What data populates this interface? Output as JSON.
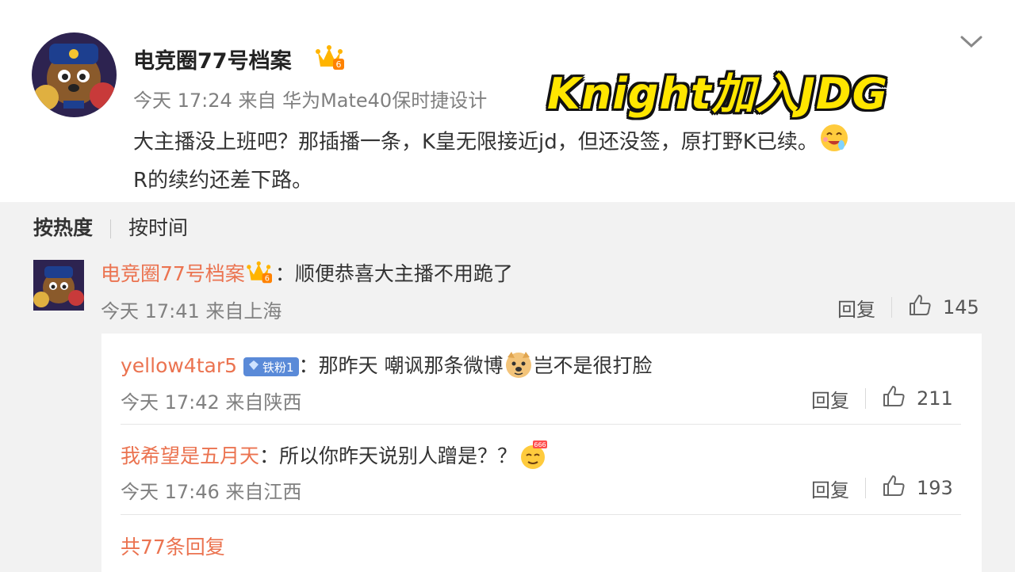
{
  "post": {
    "author": "电竞圈77号档案",
    "time": "今天 17:24",
    "source": "来自 华为Mate40保时捷设计",
    "text_line1": "大主播没上班吧？那插播一条，K皇无限接近jd，但还没签，原打野K已续。",
    "text_line2": "R的续约还差下路。",
    "banner": "Knight加入JDG"
  },
  "sort": {
    "hot": "按热度",
    "time": "按时间"
  },
  "comment": {
    "author": "电竞圈77号档案",
    "text": "：顺便恭喜大主播不用跪了",
    "meta": "今天 17:41 来自上海",
    "reply_label": "回复",
    "likes": "145"
  },
  "replies": [
    {
      "author": "yellow4tar5",
      "badge": "铁粉1",
      "text_before": "：那昨天 嘲讽那条微博",
      "text_after": "岂不是很打脸",
      "meta": "今天 17:42 来自陕西",
      "reply_label": "回复",
      "likes": "211"
    },
    {
      "author": "我希望是五月天",
      "text_before": "：所以你昨天说别人蹭是？？",
      "meta": "今天 17:46 来自江西",
      "reply_label": "回复",
      "likes": "193"
    }
  ],
  "total_replies": "共77条回复",
  "icons": [
    "chevron-down-icon",
    "crown-icon",
    "thumbs-up-icon",
    "diamond-icon",
    "emoji-drool-icon",
    "emoji-doge-icon",
    "emoji-666-icon"
  ]
}
